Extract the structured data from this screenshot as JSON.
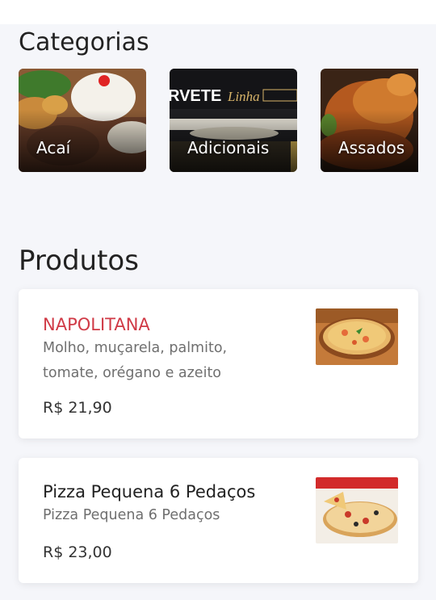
{
  "categories": {
    "title": "Categorias",
    "items": [
      {
        "label": "Acaí"
      },
      {
        "label": "Adicionais"
      },
      {
        "label": "Assados"
      }
    ]
  },
  "products": {
    "title": "Produtos",
    "items": [
      {
        "name": "NAPOLITANA",
        "description": "Molho, muçarela, palmito, tomate, orégano e azeito",
        "price": "R$ 21,90"
      },
      {
        "name": "Pizza Pequena 6 Pedaços",
        "description": "Pizza Pequena 6 Pedaços",
        "price": "R$ 23,00"
      }
    ]
  },
  "colors": {
    "accent": "#d03a46",
    "background": "#f5f6fa",
    "card": "#ffffff"
  }
}
